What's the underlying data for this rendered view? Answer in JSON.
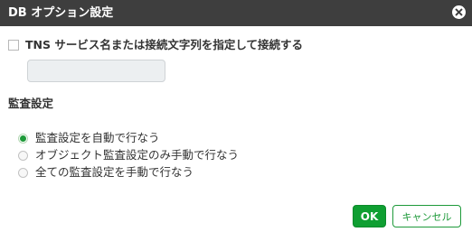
{
  "dialog": {
    "title": "DB オプション設定",
    "close_icon": "close-icon"
  },
  "tns": {
    "checkbox_label": "TNS サービス名または接続文字列を指定して接続する",
    "checked": false,
    "input_value": "",
    "input_placeholder": ""
  },
  "audit": {
    "heading": "監査設定",
    "options": [
      {
        "label": "監査設定を自動で行なう",
        "selected": true
      },
      {
        "label": "オブジェクト監査設定のみ手動で行なう",
        "selected": false
      },
      {
        "label": "全ての監査設定を手動で行なう",
        "selected": false
      }
    ]
  },
  "buttons": {
    "ok_label": "OK",
    "cancel_label": "キャンセル"
  },
  "colors": {
    "titlebar": "#3e3e3e",
    "accent_green": "#0f9f32",
    "radio_selected": "#1e9a3a"
  }
}
